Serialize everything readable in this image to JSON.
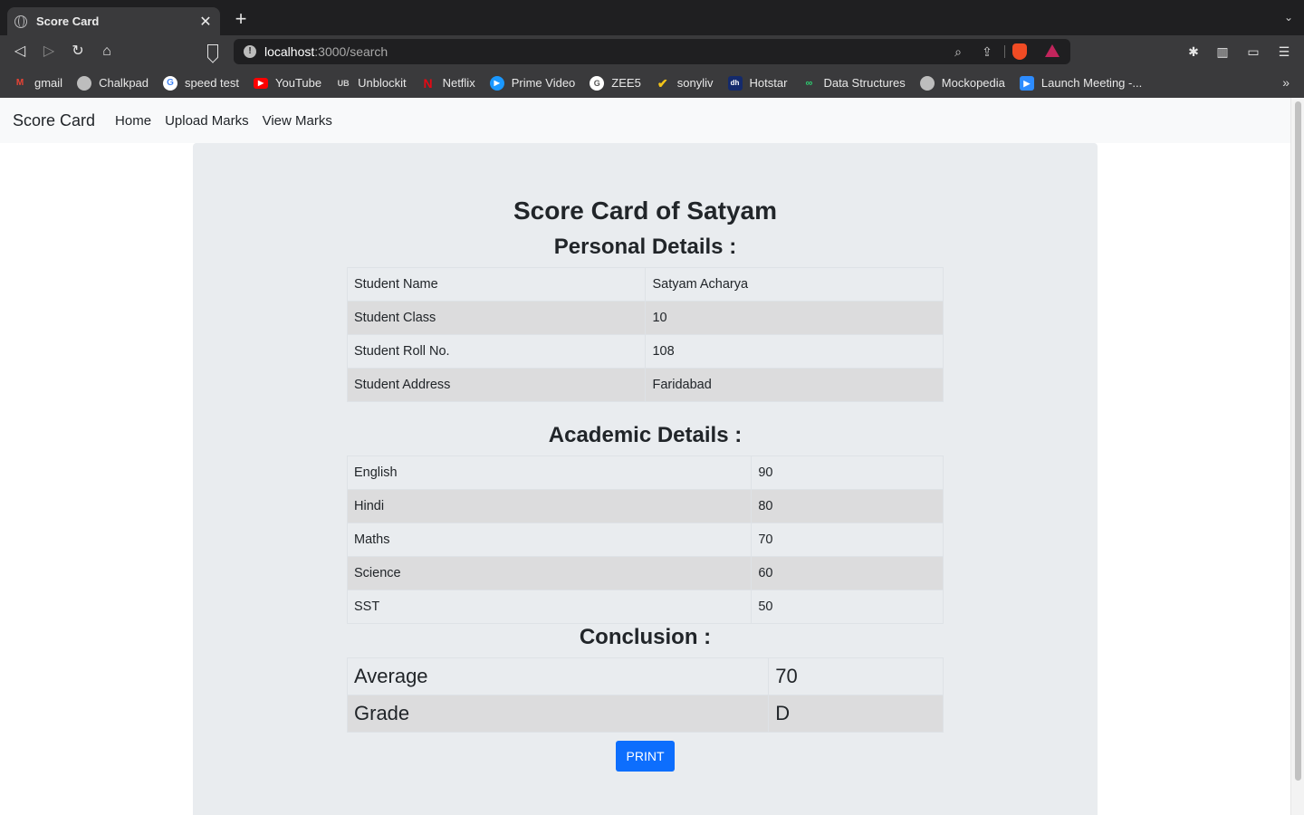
{
  "browser": {
    "tab_title": "Score Card",
    "tab_close": "✕",
    "new_tab": "+",
    "url_host": "localhost",
    "url_path": ":3000/search",
    "bookmarks": [
      {
        "label": "gmail",
        "icon": "gmail-icon"
      },
      {
        "label": "Chalkpad",
        "icon": "globe-icon"
      },
      {
        "label": "speed test",
        "icon": "google-icon"
      },
      {
        "label": "YouTube",
        "icon": "youtube-icon"
      },
      {
        "label": "Unblockit",
        "icon": "unblockit-icon"
      },
      {
        "label": "Netflix",
        "icon": "netflix-icon"
      },
      {
        "label": "Prime Video",
        "icon": "prime-video-icon"
      },
      {
        "label": "ZEE5",
        "icon": "zee5-icon"
      },
      {
        "label": "sonyliv",
        "icon": "sonyliv-icon"
      },
      {
        "label": "Hotstar",
        "icon": "hotstar-icon"
      },
      {
        "label": "Data Structures",
        "icon": "data-structures-icon"
      },
      {
        "label": "Mockopedia",
        "icon": "globe-icon"
      },
      {
        "label": "Launch Meeting -...",
        "icon": "zoom-icon"
      }
    ]
  },
  "navbar": {
    "brand": "Score Card",
    "links": [
      "Home",
      "Upload Marks",
      "View Marks"
    ]
  },
  "main": {
    "title": "Score Card of Satyam",
    "personal_heading": "Personal Details :",
    "personal": [
      {
        "label": "Student Name",
        "value": "Satyam Acharya"
      },
      {
        "label": "Student Class",
        "value": "10"
      },
      {
        "label": "Student Roll No.",
        "value": "108"
      },
      {
        "label": "Student Address",
        "value": "Faridabad"
      }
    ],
    "academic_heading": "Academic Details :",
    "academic": [
      {
        "subject": "English",
        "marks": "90"
      },
      {
        "subject": "Hindi",
        "marks": "80"
      },
      {
        "subject": "Maths",
        "marks": "70"
      },
      {
        "subject": "Science",
        "marks": "60"
      },
      {
        "subject": "SST",
        "marks": "50"
      }
    ],
    "conclusion_heading": "Conclusion :",
    "conclusion": [
      {
        "label": "Average",
        "value": "70"
      },
      {
        "label": "Grade",
        "value": "D"
      }
    ],
    "print_label": "PRINT"
  },
  "colors": {
    "accent": "#0d6efd",
    "card_bg": "#e9ecef",
    "navbar_bg": "#f8f9fa"
  }
}
